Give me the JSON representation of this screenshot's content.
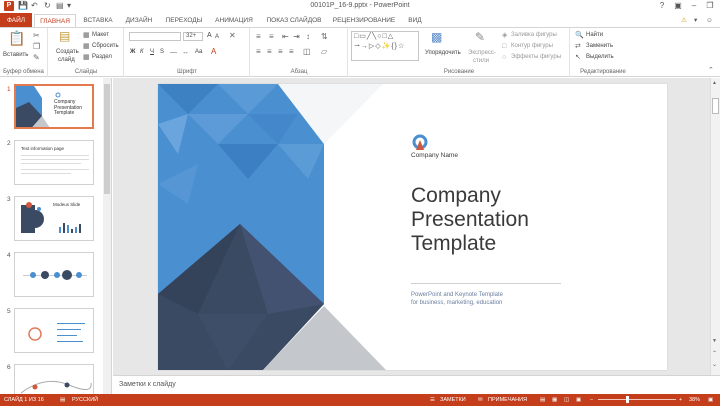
{
  "window": {
    "title": "00101P_16-9.pptx - PowerPoint",
    "app_icon": "P"
  },
  "tabs": [
    {
      "label": "ФАЙЛ"
    },
    {
      "label": "ГЛАВНАЯ"
    },
    {
      "label": "ВСТАВКА"
    },
    {
      "label": "ДИЗАЙН"
    },
    {
      "label": "ПЕРЕХОДЫ"
    },
    {
      "label": "АНИМАЦИЯ"
    },
    {
      "label": "ПОКАЗ СЛАЙДОВ"
    },
    {
      "label": "РЕЦЕНЗИРОВАНИЕ"
    },
    {
      "label": "ВИД"
    }
  ],
  "ribbon": {
    "clipboard": {
      "paste": "Вставить",
      "label": "Буфер обмена"
    },
    "slides": {
      "new_slide": "Создать",
      "new_slide_2": "слайд",
      "layout": "Макет",
      "reset": "Сбросить",
      "section": "Раздел",
      "label": "Слайды"
    },
    "font": {
      "size": "32+",
      "label": "Шрифт",
      "bold": "Ж",
      "italic": "К",
      "underline": "Ч",
      "strike": "S",
      "change_case": "Aa",
      "grow": "A",
      "shrink": "A"
    },
    "paragraph": {
      "label": "Абзац"
    },
    "drawing": {
      "arrange": "Упорядочить",
      "quick_styles": "Экспресс-",
      "quick_styles_2": "стили",
      "fill": "Заливка фигуры",
      "outline": "Контур фигуры",
      "effects": "Эффекты фигуры",
      "label": "Рисование"
    },
    "editing": {
      "find": "Найти",
      "replace": "Заменить",
      "select": "Выделить",
      "label": "Редактирование"
    }
  },
  "thumbnails": [
    {
      "num": "1",
      "title": "Company Presentation Template"
    },
    {
      "num": "2",
      "title": "Text information page"
    },
    {
      "num": "3",
      "title": "Modeus Slide"
    },
    {
      "num": "4",
      "title": ""
    },
    {
      "num": "5",
      "title": ""
    },
    {
      "num": "6",
      "title": ""
    }
  ],
  "slide": {
    "company_name": "Company Name",
    "title_line1": "Company",
    "title_line2": "Presentation",
    "title_line3": "Template",
    "subtitle_line1": "PowerPoint and Keynote Template",
    "subtitle_line2": "for business, marketing, education"
  },
  "notes": {
    "placeholder": "Заметки к слайду"
  },
  "status": {
    "slide_info": "СЛАЙД 1 ИЗ 16",
    "language": "РУССКИЙ",
    "notes_btn": "ЗАМЕТКИ",
    "comments_btn": "ПРИМЕЧАНИЯ",
    "zoom": "38%"
  },
  "colors": {
    "accent": "#c43e1c",
    "slide_blue": "#4a8fd0",
    "slide_navy": "#3b4a63",
    "slide_gray": "#bfc3c8"
  }
}
